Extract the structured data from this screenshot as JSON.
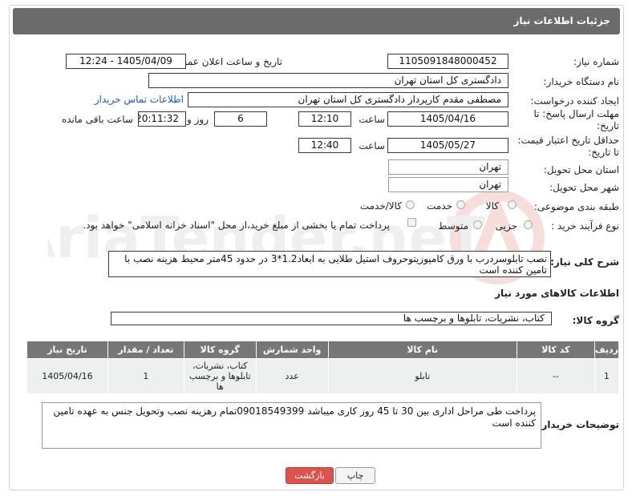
{
  "header": {
    "title": "جزئیات اطلاعات نیاز"
  },
  "fields": {
    "need_number": {
      "label": "شماره نیاز:",
      "value": "1105091848000452"
    },
    "announce_datetime": {
      "label": "تاریخ و ساعت اعلان عمومی:",
      "value": "1405/04/09 - 12:24"
    },
    "buyer_org": {
      "label": "نام دستگاه خریدار:",
      "value": "دادگستری کل استان تهران"
    },
    "requester": {
      "label": "ایجاد کننده درخواست:",
      "value": "مصطفی مقدم کارپرداز دادگستری کل استان تهران",
      "contact_link": "اطلاعات تماس خریدار"
    },
    "response_deadline": {
      "label_line1": "مهلت ارسال پاسخ: تا",
      "label_line2": "تاریخ:",
      "date": "1405/04/16",
      "time_label": "ساعت",
      "time": "12:10",
      "days": "6",
      "days_label": "روز و",
      "remaining": "20:11:32",
      "remaining_label": "ساعت باقی مانده"
    },
    "price_validity": {
      "label_line1": "حداقل تاریخ اعتبار قیمت:",
      "label_line2": "تا تاریخ:",
      "date": "1405/05/27",
      "time_label": "ساعت",
      "time": "12:40"
    },
    "delivery_province": {
      "label": "استان محل تحویل:",
      "value": "تهران"
    },
    "delivery_city": {
      "label": "شهر محل تحویل:",
      "value": "تهران"
    },
    "category": {
      "label": "طبقه بندی موضوعی:",
      "options": [
        "کالا",
        "خدمت",
        "کالا/خدمت"
      ]
    },
    "purchase_type": {
      "label": "نوع فرآیند خرید :",
      "options": [
        "جزیی",
        "متوسط"
      ],
      "treasury_note": "پرداخت تمام یا بخشی از مبلغ خرید،از محل \"اسناد خزانه اسلامی\" خواهد بود."
    }
  },
  "description": {
    "label": "شرح کلی نیاز:",
    "value": "نصب تابلوسردرب با ورق کامپوزیتوحروف استیل طلایی به ابعاد1.2*3 در حدود 45متر محیط  هزینه نصب با تامین کننده است"
  },
  "goods_section": {
    "title": "اطلاعات کالاهای مورد نیاز",
    "group_label": "گروه کالا:",
    "group_value": "کتاب، نشریات، تابلوها و برچسب ها",
    "columns": [
      "ردیف",
      "کد کالا",
      "نام کالا",
      "واحد شمارش",
      "گروه کالا",
      "تعداد / مقدار",
      "تاریخ نیاز"
    ],
    "rows": [
      {
        "row": "1",
        "code": "--",
        "name": "تابلو",
        "unit": "عدد",
        "group": "کتاب، نشریات، تابلوها و برچسب ها",
        "qty": "1",
        "date": "1405/04/16"
      }
    ]
  },
  "buyer_notes": {
    "label": "توضیحات خریدار:",
    "value": "پرداخت طی مراحل اداری  بین 30 تا 45 روز کاری میباشد 09018549399تمام رهزینه نصب  وتحویل جنس به عهده تامین کننده است"
  },
  "buttons": {
    "print": "چاپ",
    "back": "بازگشت"
  },
  "watermark": {
    "text": "AriaTender.neT"
  },
  "colors": {
    "header_bg": "#6b6b6b",
    "link": "#1f5aa8",
    "back_button": "#d9534f",
    "table_header": "#777777"
  }
}
